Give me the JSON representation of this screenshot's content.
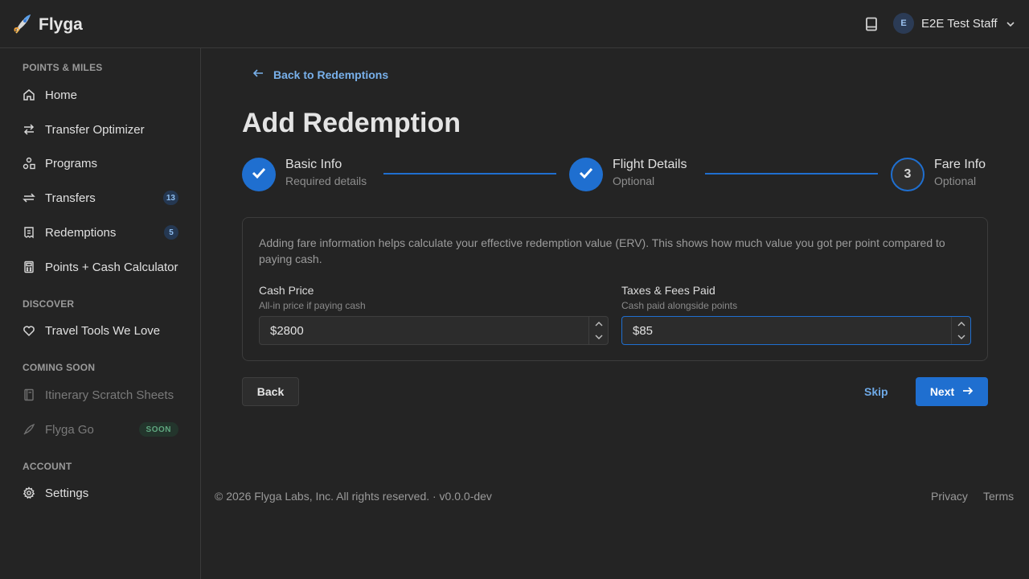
{
  "app": {
    "name": "Flyga"
  },
  "header": {
    "user_initial": "E",
    "user_name": "E2E Test Staff"
  },
  "sidebar": {
    "sections": [
      {
        "title": "POINTS & MILES",
        "items": [
          {
            "label": "Home",
            "icon": "home-icon"
          },
          {
            "label": "Transfer Optimizer",
            "icon": "arrows-icon"
          },
          {
            "label": "Programs",
            "icon": "shapes-icon"
          },
          {
            "label": "Transfers",
            "icon": "transfer-icon",
            "badge": "13"
          },
          {
            "label": "Redemptions",
            "icon": "receipt-icon",
            "badge": "5"
          },
          {
            "label": "Points + Cash Calculator",
            "icon": "calculator-icon"
          }
        ]
      },
      {
        "title": "DISCOVER",
        "items": [
          {
            "label": "Travel Tools We Love",
            "icon": "heart-icon"
          }
        ]
      },
      {
        "title": "COMING SOON",
        "items": [
          {
            "label": "Itinerary Scratch Sheets",
            "icon": "notebook-icon",
            "disabled": true
          },
          {
            "label": "Flyga Go",
            "icon": "rocket-icon",
            "disabled": true,
            "tag": "SOON"
          }
        ]
      },
      {
        "title": "ACCOUNT",
        "items": [
          {
            "label": "Settings",
            "icon": "gear-icon"
          }
        ]
      }
    ]
  },
  "main": {
    "back_link": "Back to Redemptions",
    "title": "Add Redemption",
    "steps": [
      {
        "title": "Basic Info",
        "subtitle": "Required details",
        "state": "complete"
      },
      {
        "title": "Flight Details",
        "subtitle": "Optional",
        "state": "complete"
      },
      {
        "title": "Fare Info",
        "subtitle": "Optional",
        "state": "current",
        "number": "3"
      }
    ],
    "card": {
      "description": "Adding fare information helps calculate your effective redemption value (ERV). This shows how much value you got per point compared to paying cash.",
      "cash_price": {
        "label": "Cash Price",
        "hint": "All-in price if paying cash",
        "value": "$2800"
      },
      "taxes_fees": {
        "label": "Taxes & Fees Paid",
        "hint": "Cash paid alongside points",
        "value": "$85"
      }
    },
    "buttons": {
      "back": "Back",
      "skip": "Skip",
      "next": "Next"
    }
  },
  "footer": {
    "copyright": "© 2026 Flyga Labs, Inc. All rights reserved. · v0.0.0-dev",
    "privacy": "Privacy",
    "terms": "Terms"
  },
  "colors": {
    "accent": "#1f6fd0",
    "link": "#78b0ea",
    "background": "#242424"
  }
}
